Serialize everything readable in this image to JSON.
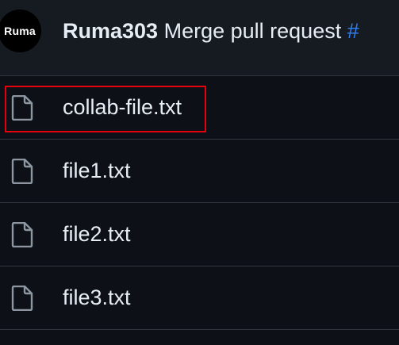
{
  "commit": {
    "avatar_text": "Ruma",
    "author": "Ruma303",
    "message": "Merge pull request",
    "link_fragment": "#"
  },
  "files": [
    {
      "name": "collab-file.txt",
      "icon": "file-icon",
      "highlighted": true
    },
    {
      "name": "file1.txt",
      "icon": "file-icon",
      "highlighted": false
    },
    {
      "name": "file2.txt",
      "icon": "file-icon",
      "highlighted": false
    },
    {
      "name": "file3.txt",
      "icon": "file-icon",
      "highlighted": false
    }
  ],
  "colors": {
    "background": "#0d1117",
    "header_background": "#161b22",
    "border": "#30363d",
    "text": "#e6edf3",
    "link": "#2f81f7",
    "icon": "#8d96a0",
    "highlight": "#e5000d"
  }
}
